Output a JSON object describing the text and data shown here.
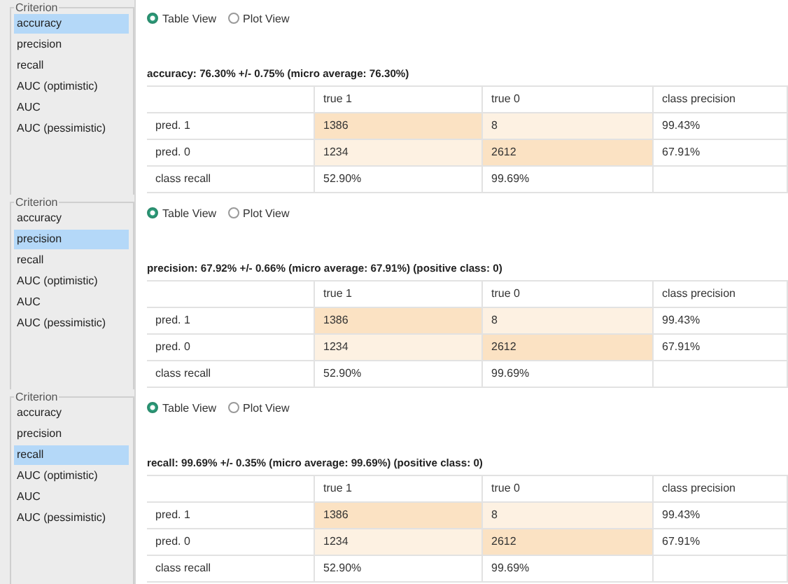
{
  "panels": [
    {
      "criteria": [
        {
          "label": "accuracy",
          "selected": true
        },
        {
          "label": "precision",
          "selected": false
        },
        {
          "label": "recall",
          "selected": false
        },
        {
          "label": "AUC (optimistic)",
          "selected": false
        },
        {
          "label": "AUC",
          "selected": false
        },
        {
          "label": "AUC (pessimistic)",
          "selected": false
        }
      ],
      "criteria_title": "Criterion",
      "views": [
        {
          "label": "Table View",
          "selected": true
        },
        {
          "label": "Plot View",
          "selected": false
        }
      ],
      "title": "accuracy: 76.30% +/- 0.75% (micro average: 76.30%)",
      "table": {
        "columns": [
          "true 1",
          "true 0",
          "class precision"
        ],
        "rows": [
          {
            "label": "pred. 1",
            "cells": [
              {
                "text": "1386",
                "color": "#fbe2c3"
              },
              {
                "text": "8",
                "color": "#fdf1e2"
              },
              {
                "text": "99.43%"
              }
            ]
          },
          {
            "label": "pred. 0",
            "cells": [
              {
                "text": "1234",
                "color": "#fdf1e2"
              },
              {
                "text": "2612",
                "color": "#fbe2c3"
              },
              {
                "text": "67.91%"
              }
            ]
          },
          {
            "label": "class recall",
            "cells": [
              {
                "text": "52.90%"
              },
              {
                "text": "99.69%"
              }
            ]
          }
        ]
      }
    },
    {
      "criteria": [
        {
          "label": "accuracy",
          "selected": false
        },
        {
          "label": "precision",
          "selected": true
        },
        {
          "label": "recall",
          "selected": false
        },
        {
          "label": "AUC (optimistic)",
          "selected": false
        },
        {
          "label": "AUC",
          "selected": false
        },
        {
          "label": "AUC (pessimistic)",
          "selected": false
        }
      ],
      "criteria_title": "Criterion",
      "views": [
        {
          "label": "Table View",
          "selected": true
        },
        {
          "label": "Plot View",
          "selected": false
        }
      ],
      "title": "precision: 67.92% +/- 0.66% (micro average: 67.91%) (positive class: 0)",
      "table": {
        "columns": [
          "true 1",
          "true 0",
          "class precision"
        ],
        "rows": [
          {
            "label": "pred. 1",
            "cells": [
              {
                "text": "1386",
                "color": "#fbe2c3"
              },
              {
                "text": "8",
                "color": "#fdf1e2"
              },
              {
                "text": "99.43%"
              }
            ]
          },
          {
            "label": "pred. 0",
            "cells": [
              {
                "text": "1234",
                "color": "#fdf1e2"
              },
              {
                "text": "2612",
                "color": "#fbe2c3"
              },
              {
                "text": "67.91%"
              }
            ]
          },
          {
            "label": "class recall",
            "cells": [
              {
                "text": "52.90%"
              },
              {
                "text": "99.69%"
              }
            ]
          }
        ]
      }
    },
    {
      "criteria": [
        {
          "label": "accuracy",
          "selected": false
        },
        {
          "label": "precision",
          "selected": false
        },
        {
          "label": "recall",
          "selected": true
        },
        {
          "label": "AUC (optimistic)",
          "selected": false
        },
        {
          "label": "AUC",
          "selected": false
        },
        {
          "label": "AUC (pessimistic)",
          "selected": false
        }
      ],
      "criteria_title": "Criterion",
      "views": [
        {
          "label": "Table View",
          "selected": true
        },
        {
          "label": "Plot View",
          "selected": false
        }
      ],
      "title": "recall: 99.69% +/- 0.35% (micro average: 99.69%) (positive class: 0)",
      "table": {
        "columns": [
          "true 1",
          "true 0",
          "class precision"
        ],
        "rows": [
          {
            "label": "pred. 1",
            "cells": [
              {
                "text": "1386",
                "color": "#fbe2c3"
              },
              {
                "text": "8",
                "color": "#fdf1e2"
              },
              {
                "text": "99.43%"
              }
            ]
          },
          {
            "label": "pred. 0",
            "cells": [
              {
                "text": "1234",
                "color": "#fdf1e2"
              },
              {
                "text": "2612",
                "color": "#fbe2c3"
              },
              {
                "text": "67.91%"
              }
            ]
          },
          {
            "label": "class recall",
            "cells": [
              {
                "text": "52.90%"
              },
              {
                "text": "99.69%"
              }
            ]
          }
        ]
      }
    }
  ]
}
